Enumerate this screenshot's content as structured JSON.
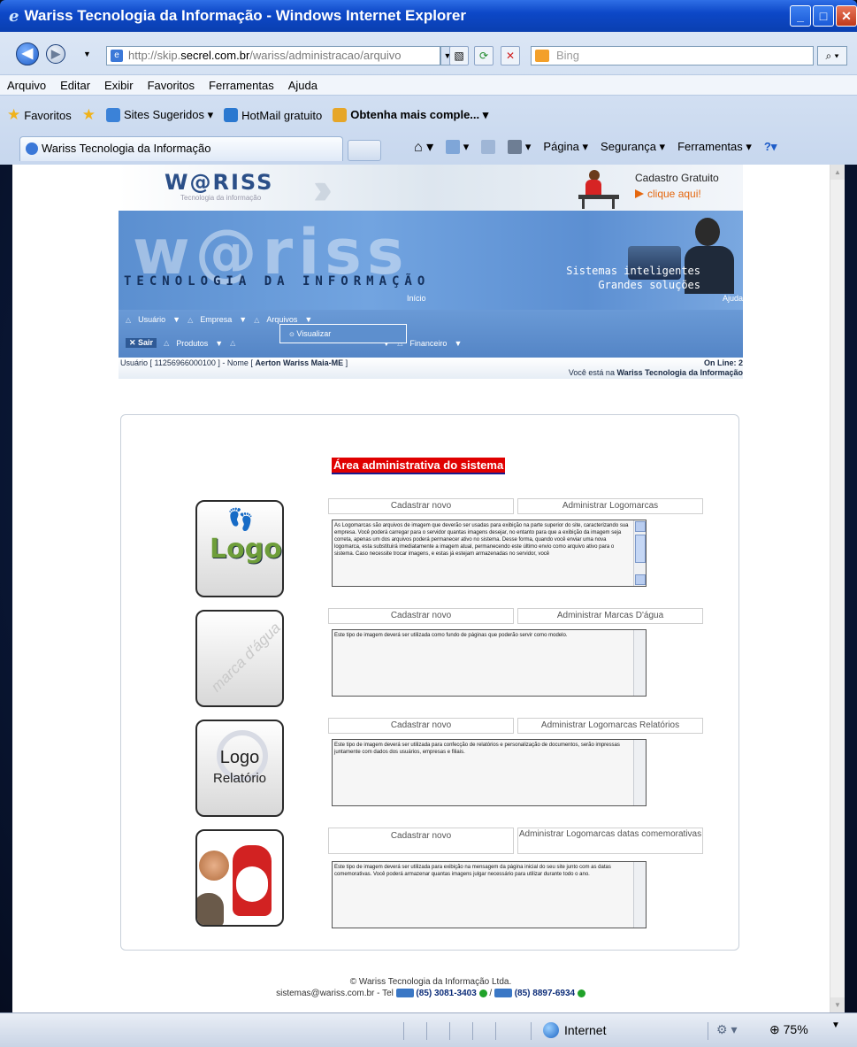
{
  "window": {
    "title": "Wariss Tecnologia da Informação - Windows Internet Explorer"
  },
  "toolbar": {
    "address_prefix": "http://skip.",
    "address_domain": "secrel.com.br",
    "address_path": "/wariss/administracao/arquivo",
    "search_placeholder": "Bing"
  },
  "menubar": [
    "Arquivo",
    "Editar",
    "Exibir",
    "Favoritos",
    "Ferramentas",
    "Ajuda"
  ],
  "favorites": {
    "label": "Favoritos",
    "items": [
      "Sites Sugeridos ▾",
      "HotMail gratuito",
      "Obtenha mais comple... ▾"
    ]
  },
  "tab": {
    "label": "Wariss Tecnologia da Informação"
  },
  "commandbar": [
    "Página ▾",
    "Segurança ▾",
    "Ferramentas ▾"
  ],
  "status": {
    "zone": "Internet",
    "zoom": "75%"
  },
  "site": {
    "small_logo": "W@RISS",
    "small_logo_sub": "Tecnologia da informação",
    "cadastro": "Cadastro Gratuito",
    "clique": "clique aqui!",
    "big_logo": "w@riss",
    "tagline": "TECNOLOGIA DA INFORMAÇÃO",
    "slogan_1": "Sistemas inteligentes",
    "slogan_2": "Grandes soluções",
    "inicio": "Início",
    "ajuda": "Ajuda",
    "menu_row1": [
      "Usuário",
      "Empresa",
      "Arquivos"
    ],
    "menu_sair": "Sair",
    "menu_row2": [
      "Produtos",
      "",
      "",
      "Financeiro"
    ],
    "dropdown_item": "Visualizar",
    "user_line_a": "Usuário [ 11256966000100 ] - Nome [ ",
    "user_name": "Aerton Wariss Maia-ME",
    "user_line_b": " ]",
    "online": "On Line: 2",
    "location_a": "Você está na ",
    "location_b": "Wariss Tecnologia da Informação",
    "area_title": "Área administrativa do sistema",
    "items": [
      {
        "cad": "Cadastrar novo",
        "adm": "Administrar Logomarcas",
        "text": "As Logomarcas são arquivos de imagem que deverão ser usadas para exibição na parte superior do site, caracterizando sua empresa. Você poderá carregar para o servidor quantas imagens desejar, no entanto para que a exibição da imagem seja correta, apenas um dos arquivos poderá permanecer ativo no sistema. Desse forma, quando você enviar uma nova logomarca, esta substituirá imediatamente a imagem atual, permanecendo este último envio como arquivo ativo para o sistema. Caso necessite trocar imagens, e estas já estejam armazenadas no servidor, você",
        "img": "Logo"
      },
      {
        "cad": "Cadastrar novo",
        "adm": "Administrar Marcas D'água",
        "text": "Este tipo de imagem deverá ser utilizada como fundo de páginas que poderão servir como modelo.",
        "img": "marca d'água"
      },
      {
        "cad": "Cadastrar novo",
        "adm": "Administrar Logomarcas Relatórios",
        "text": "Este tipo de imagem deverá ser utilizada para confecção de relatórios e personalização de documentos, serão impressas juntamente com dados dos usuários, empresas e filiais.",
        "img_1": "Logo",
        "img_2": "Relatório"
      },
      {
        "cad": "Cadastrar novo",
        "adm": "Administrar Logomarcas datas comemorativas",
        "text": "Este tipo de imagem deverá ser utilizada para exibição na mensagem da página inicial do seu site junto com as datas comemorativas. Você poderá armazenar quantas imagens julgar necessário para utilizar durante todo o ano."
      }
    ],
    "footer_1": "© Wariss Tecnologia da Informação Ltda.",
    "footer_email": "sistemas@wariss.com.br - Tel ",
    "phone_1": "(85) 3081-3403",
    "footer_sep": " / ",
    "phone_2": "(85) 8897-6934"
  },
  "colors": {
    "title_bar": "#0d48c8",
    "banner": "#5b8fd0",
    "area_title_bg": "#e00000",
    "cta": "#e4670f"
  }
}
